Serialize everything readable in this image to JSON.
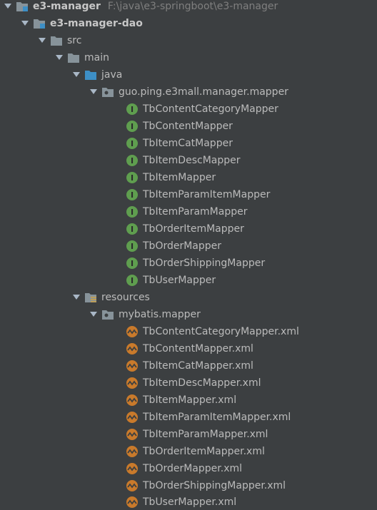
{
  "tree": {
    "root": {
      "label": "e3-manager",
      "path": "F:\\java\\e3-springboot\\e3-manager"
    },
    "module": {
      "label": "e3-manager-dao"
    },
    "src": {
      "label": "src"
    },
    "main": {
      "label": "main"
    },
    "java": {
      "label": "java"
    },
    "mapper_package": {
      "label": "guo.ping.e3mall.manager.mapper"
    },
    "java_files": [
      "TbContentCategoryMapper",
      "TbContentMapper",
      "TbItemCatMapper",
      "TbItemDescMapper",
      "TbItemMapper",
      "TbItemParamItemMapper",
      "TbItemParamMapper",
      "TbOrderItemMapper",
      "TbOrderMapper",
      "TbOrderShippingMapper",
      "TbUserMapper"
    ],
    "resources": {
      "label": "resources"
    },
    "xml_package": {
      "label": "mybatis.mapper"
    },
    "xml_files": [
      "TbContentCategoryMapper.xml",
      "TbContentMapper.xml",
      "TbItemCatMapper.xml",
      "TbItemDescMapper.xml",
      "TbItemMapper.xml",
      "TbItemParamItemMapper.xml",
      "TbItemParamMapper.xml",
      "TbOrderItemMapper.xml",
      "TbOrderMapper.xml",
      "TbOrderShippingMapper.xml",
      "TbUserMapper.xml"
    ]
  },
  "colors": {
    "background": "#3c3f41",
    "text": "#bbbbbb",
    "path_text": "#7f7f7f",
    "folder": "#87939a",
    "source_folder": "#3d8fc6",
    "interface_badge": "#5f9e4f",
    "xml_badge": "#c97a2b"
  }
}
